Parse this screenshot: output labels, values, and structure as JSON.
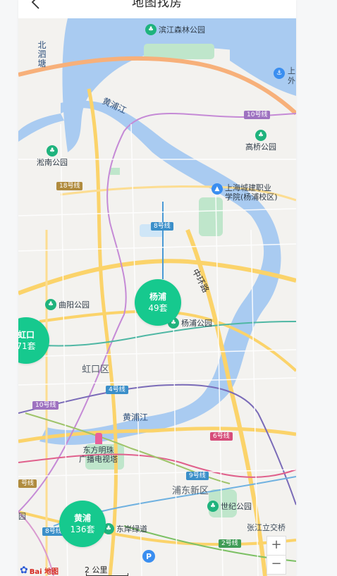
{
  "header": {
    "title": "地图找房"
  },
  "map": {
    "colors": {
      "water": "#a9cbf1",
      "expressway": "#fbd36a",
      "green": "#bfe6cb",
      "bubble": "#16c98e",
      "poi_green": "#1fb37d",
      "poi_blue": "#3a8ef0"
    },
    "labels": {
      "beisi": "北泗塘",
      "huangpu_top": "黄浦江",
      "huangpu_mid": "黄浦江",
      "hongkou": "虹口区",
      "pudong": "浦东新区",
      "zhonghuan": "中环路",
      "zhangjiang": "张江立交桥",
      "dongfang": "东方明珠\n广播电视塔",
      "right_edge_top": "上",
      "right_edge_bot": "外",
      "left_edge": "园"
    },
    "metro": [
      "18号线",
      "8号线",
      "10号线",
      "4号线",
      "10号线",
      "6号线",
      "9号线",
      "2号线",
      "8号线",
      "号线"
    ],
    "pois": {
      "binjiang": "滨江森林公园",
      "gaoqiao": "高桥公园",
      "songnan": "淞南公园",
      "chengjian": "上海城建职业\n学院(杨浦校区)",
      "quyang": "曲阳公园",
      "yangpu_park": "杨浦公园",
      "century": "世纪公园",
      "dongan": "东岸绿道"
    },
    "bubbles": [
      {
        "name": "杨浦",
        "count": "49套"
      },
      {
        "name": "虹口",
        "count": "71套"
      },
      {
        "name": "黄浦",
        "count": "136套"
      }
    ],
    "controls": {
      "zoom_in": "+",
      "zoom_out": "−"
    },
    "scale": "2 公里",
    "logo": "Bai 地图"
  }
}
